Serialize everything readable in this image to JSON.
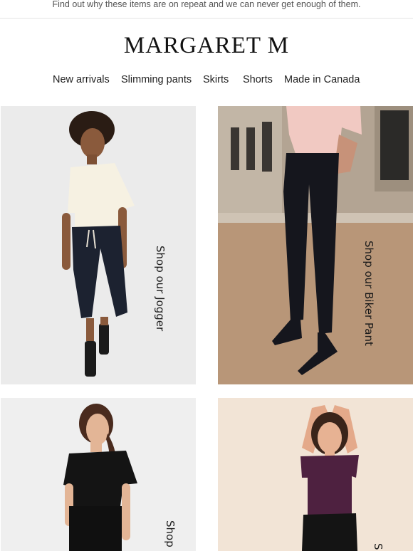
{
  "preheader": {
    "text": "Find out why these items are on repeat and we can never get enough of them."
  },
  "brand": {
    "name": "MARGARET M"
  },
  "nav": {
    "items": [
      {
        "label": "New arrivals"
      },
      {
        "label": "Slimming pants"
      },
      {
        "label": "Skirts"
      },
      {
        "label": "Shorts"
      },
      {
        "label": "Made in Canada"
      }
    ]
  },
  "products": [
    {
      "caption": "Shop our Jogger",
      "image": "woman-white-shirt-black-joggers"
    },
    {
      "caption": "Shop our Biker Pant",
      "image": "woman-pink-shirt-black-pants-street"
    },
    {
      "caption": "Shop",
      "image": "woman-black-tee-black-pants"
    },
    {
      "caption": "S",
      "image": "woman-purple-ribbed-top"
    }
  ],
  "colors": {
    "accent": "#111111",
    "tile_grey": "#ebebeb",
    "tile_peach": "#f2e4d6",
    "street_stone": "#a89a8a"
  }
}
